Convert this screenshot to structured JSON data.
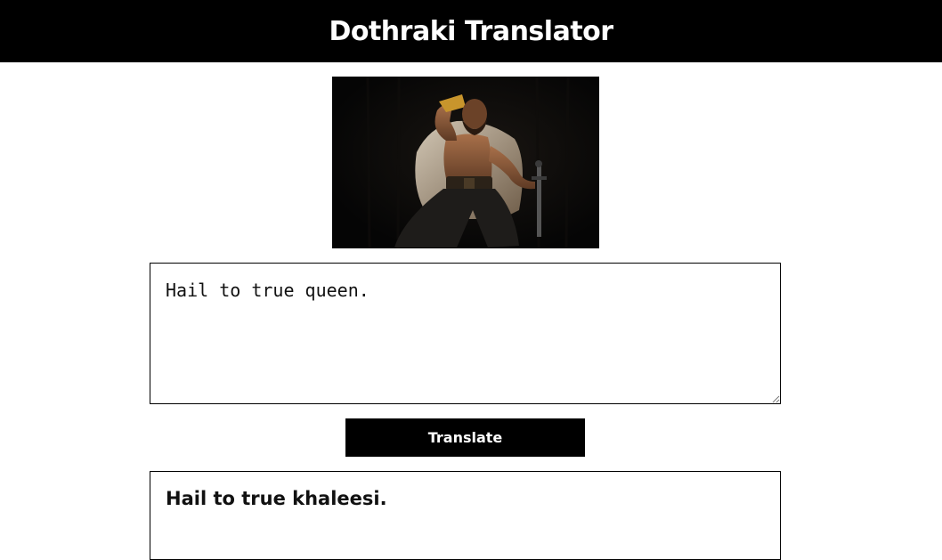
{
  "header": {
    "title": "Dothraki Translator"
  },
  "hero": {
    "image_name": "dothraki-warrior-image"
  },
  "input": {
    "value": "Hail to true queen."
  },
  "button": {
    "label": "Translate"
  },
  "output": {
    "text": "Hail to true khaleesi."
  },
  "colors": {
    "header_bg": "#000000",
    "button_bg": "#000000",
    "text_on_dark": "#ffffff",
    "page_bg": "#ffffff"
  }
}
